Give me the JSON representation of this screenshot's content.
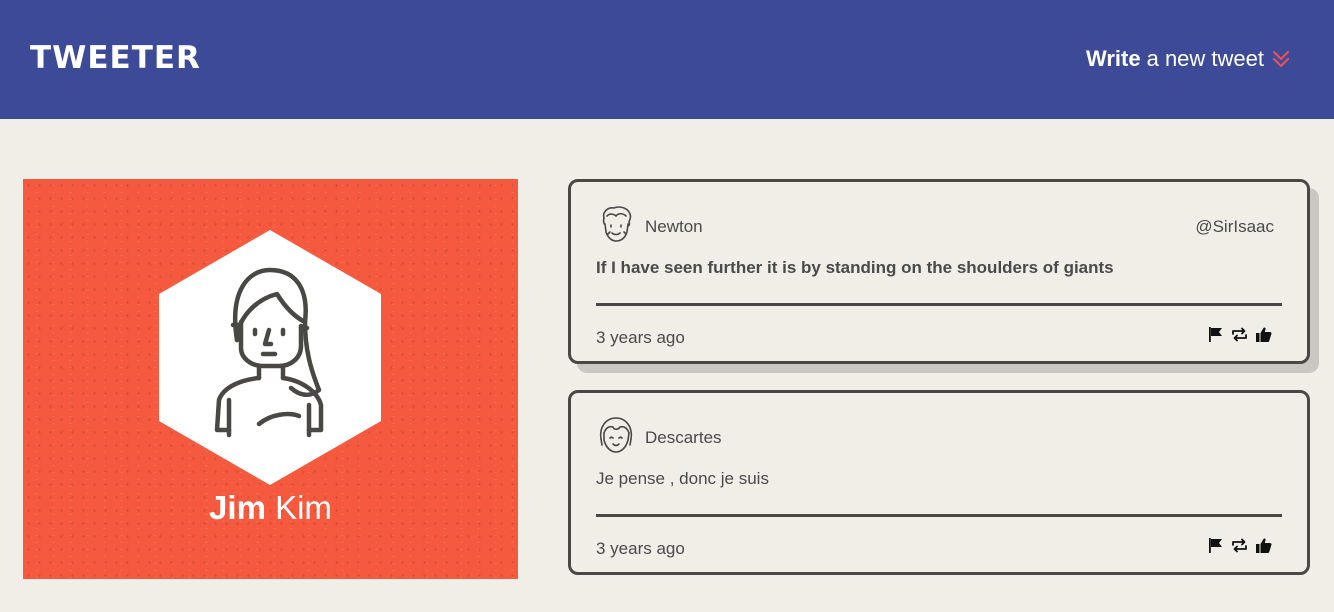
{
  "nav": {
    "brand": "TWEETER",
    "write_bold": "Write",
    "write_rest": "a new tweet",
    "write_icon": "double-chevron-down-icon",
    "accent_color": "#e8505b"
  },
  "profile": {
    "first_name": "Jim",
    "last_name": "Kim",
    "background_color": "#f55a3f"
  },
  "tweets": [
    {
      "name": "Newton",
      "handle": "@SirIsaac",
      "content": "If I have seen further it is by standing on the shoulders of giants",
      "time": "3 years ago",
      "avatar": "curly-hair-man-avatar"
    },
    {
      "name": "Descartes",
      "handle": "",
      "content": "Je pense , donc je suis",
      "time": "3 years ago",
      "avatar": "bangs-girl-avatar"
    }
  ],
  "actions": [
    "flag-icon",
    "retweet-icon",
    "like-icon"
  ],
  "colors": {
    "navbar": "#3c4a98",
    "page_bg": "#f1eee8",
    "card_border": "#4a4845"
  }
}
